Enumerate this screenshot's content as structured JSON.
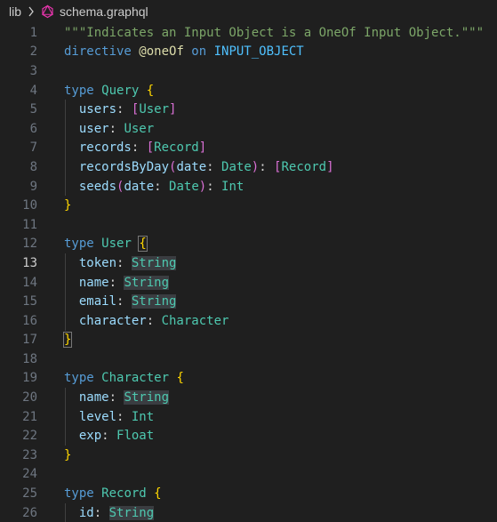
{
  "breadcrumb": {
    "folder": "lib",
    "file": "schema.graphql"
  },
  "colors": {
    "background": "#1f1f1f",
    "keyword": "#569cd6",
    "type": "#4ec9b0",
    "field": "#9cdcfe",
    "brace": "#ffd700",
    "bracket": "#da70d6"
  },
  "active_line": 13,
  "lines": [
    {
      "num": "1",
      "tokens": [
        {
          "t": "\"\"\"Indicates an Input Object is a OneOf Input Object.\"\"\"",
          "c": "doc"
        }
      ]
    },
    {
      "num": "2",
      "tokens": [
        {
          "t": "directive ",
          "c": "kw"
        },
        {
          "t": "@oneOf",
          "c": "dir"
        },
        {
          "t": " on ",
          "c": "kw"
        },
        {
          "t": "INPUT_OBJECT",
          "c": "const"
        }
      ]
    },
    {
      "num": "3",
      "tokens": []
    },
    {
      "num": "4",
      "tokens": [
        {
          "t": "type ",
          "c": "kw"
        },
        {
          "t": "Query",
          "c": "type"
        },
        {
          "t": " ",
          "c": "punc"
        },
        {
          "t": "{",
          "c": "brace"
        }
      ]
    },
    {
      "num": "5",
      "tokens": [
        {
          "t": "  users",
          "c": "field"
        },
        {
          "t": ": ",
          "c": "punc"
        },
        {
          "t": "[",
          "c": "bracket"
        },
        {
          "t": "User",
          "c": "type"
        },
        {
          "t": "]",
          "c": "bracket"
        }
      ]
    },
    {
      "num": "6",
      "tokens": [
        {
          "t": "  user",
          "c": "field"
        },
        {
          "t": ": ",
          "c": "punc"
        },
        {
          "t": "User",
          "c": "type"
        }
      ]
    },
    {
      "num": "7",
      "tokens": [
        {
          "t": "  records",
          "c": "field"
        },
        {
          "t": ": ",
          "c": "punc"
        },
        {
          "t": "[",
          "c": "bracket"
        },
        {
          "t": "Record",
          "c": "type"
        },
        {
          "t": "]",
          "c": "bracket"
        }
      ]
    },
    {
      "num": "8",
      "tokens": [
        {
          "t": "  recordsByDay",
          "c": "field"
        },
        {
          "t": "(",
          "c": "paren"
        },
        {
          "t": "date",
          "c": "field"
        },
        {
          "t": ": ",
          "c": "punc"
        },
        {
          "t": "Date",
          "c": "type"
        },
        {
          "t": ")",
          "c": "paren"
        },
        {
          "t": ": ",
          "c": "punc"
        },
        {
          "t": "[",
          "c": "bracket"
        },
        {
          "t": "Record",
          "c": "type"
        },
        {
          "t": "]",
          "c": "bracket"
        }
      ]
    },
    {
      "num": "9",
      "tokens": [
        {
          "t": "  seeds",
          "c": "field"
        },
        {
          "t": "(",
          "c": "paren"
        },
        {
          "t": "date",
          "c": "field"
        },
        {
          "t": ": ",
          "c": "punc"
        },
        {
          "t": "Date",
          "c": "type"
        },
        {
          "t": ")",
          "c": "paren"
        },
        {
          "t": ": ",
          "c": "punc"
        },
        {
          "t": "Int",
          "c": "type"
        }
      ]
    },
    {
      "num": "10",
      "tokens": [
        {
          "t": "}",
          "c": "brace"
        }
      ]
    },
    {
      "num": "11",
      "tokens": []
    },
    {
      "num": "12",
      "tokens": [
        {
          "t": "type ",
          "c": "kw"
        },
        {
          "t": "User",
          "c": "type"
        },
        {
          "t": " ",
          "c": "punc"
        },
        {
          "t": "{",
          "c": "brace",
          "box": true
        }
      ]
    },
    {
      "num": "13",
      "tokens": [
        {
          "t": "  token",
          "c": "field"
        },
        {
          "t": ": ",
          "c": "punc"
        },
        {
          "t": "String",
          "c": "type",
          "hl": true
        }
      ]
    },
    {
      "num": "14",
      "tokens": [
        {
          "t": "  name",
          "c": "field"
        },
        {
          "t": ": ",
          "c": "punc"
        },
        {
          "t": "String",
          "c": "type",
          "hl": true
        }
      ]
    },
    {
      "num": "15",
      "tokens": [
        {
          "t": "  email",
          "c": "field"
        },
        {
          "t": ": ",
          "c": "punc"
        },
        {
          "t": "String",
          "c": "type",
          "hl": true
        }
      ]
    },
    {
      "num": "16",
      "tokens": [
        {
          "t": "  character",
          "c": "field"
        },
        {
          "t": ": ",
          "c": "punc"
        },
        {
          "t": "Character",
          "c": "type"
        }
      ]
    },
    {
      "num": "17",
      "tokens": [
        {
          "t": "}",
          "c": "brace",
          "box": true
        }
      ]
    },
    {
      "num": "18",
      "tokens": []
    },
    {
      "num": "19",
      "tokens": [
        {
          "t": "type ",
          "c": "kw"
        },
        {
          "t": "Character",
          "c": "type"
        },
        {
          "t": " ",
          "c": "punc"
        },
        {
          "t": "{",
          "c": "brace"
        }
      ]
    },
    {
      "num": "20",
      "tokens": [
        {
          "t": "  name",
          "c": "field"
        },
        {
          "t": ": ",
          "c": "punc"
        },
        {
          "t": "String",
          "c": "type",
          "hl": true
        }
      ]
    },
    {
      "num": "21",
      "tokens": [
        {
          "t": "  level",
          "c": "field"
        },
        {
          "t": ": ",
          "c": "punc"
        },
        {
          "t": "Int",
          "c": "type"
        }
      ]
    },
    {
      "num": "22",
      "tokens": [
        {
          "t": "  exp",
          "c": "field"
        },
        {
          "t": ": ",
          "c": "punc"
        },
        {
          "t": "Float",
          "c": "type"
        }
      ]
    },
    {
      "num": "23",
      "tokens": [
        {
          "t": "}",
          "c": "brace"
        }
      ]
    },
    {
      "num": "24",
      "tokens": []
    },
    {
      "num": "25",
      "tokens": [
        {
          "t": "type ",
          "c": "kw"
        },
        {
          "t": "Record",
          "c": "type"
        },
        {
          "t": " ",
          "c": "punc"
        },
        {
          "t": "{",
          "c": "brace"
        }
      ]
    },
    {
      "num": "26",
      "tokens": [
        {
          "t": "  id",
          "c": "field"
        },
        {
          "t": ": ",
          "c": "punc"
        },
        {
          "t": "String",
          "c": "type",
          "hl": true
        }
      ]
    }
  ]
}
